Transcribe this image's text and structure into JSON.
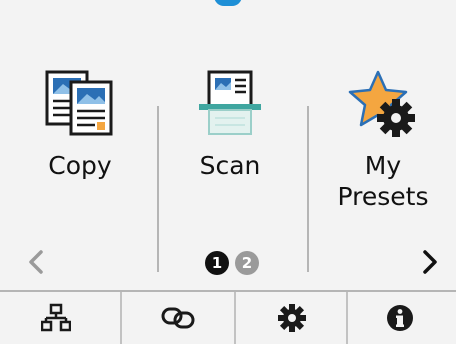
{
  "tiles": [
    {
      "label": "Copy",
      "icon": "copy-icon"
    },
    {
      "label": "Scan",
      "icon": "scan-icon"
    },
    {
      "label": "My\nPresets",
      "icon": "my-presets-star-gear-icon"
    }
  ],
  "pager": {
    "current_page": "1",
    "other_page": "2",
    "prev_icon": "chevron-left-icon",
    "next_icon": "chevron-right-icon"
  },
  "bottom_bar": [
    {
      "icon": "network-icon"
    },
    {
      "icon": "wireless-connect-icon"
    },
    {
      "icon": "settings-gear-icon"
    },
    {
      "icon": "info-icon"
    }
  ],
  "colors": {
    "accent": "#1e8fd6",
    "star": "#f4a640",
    "scanner_teal": "#3fa6a0"
  }
}
